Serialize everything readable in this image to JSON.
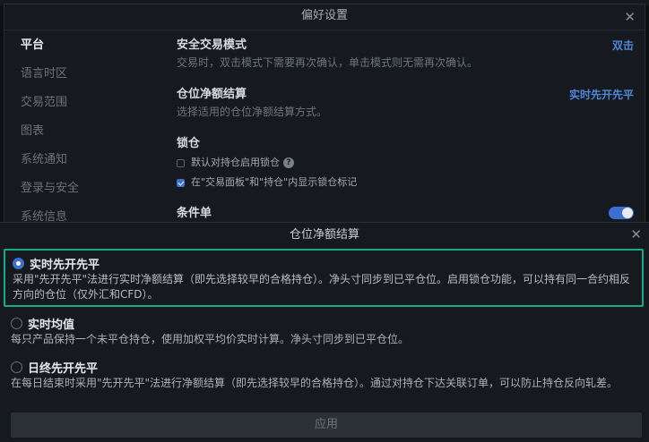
{
  "preferences": {
    "title": "偏好设置",
    "close_glyph": "✕",
    "sidebar": {
      "items": [
        {
          "label": "平台",
          "active": true
        },
        {
          "label": "语言时区",
          "active": false
        },
        {
          "label": "交易范围",
          "active": false
        },
        {
          "label": "图表",
          "active": false
        },
        {
          "label": "系统通知",
          "active": false
        },
        {
          "label": "登录与安全",
          "active": false
        },
        {
          "label": "系统信息",
          "active": false
        }
      ]
    },
    "sections": {
      "safe_trade": {
        "title": "安全交易模式",
        "desc": "交易时，双击模式下需要再次确认，单击模式则无需再次确认。",
        "value": "双击"
      },
      "netting": {
        "title": "仓位净额结算",
        "desc": "选择适用的仓位净额结算方式。",
        "value": "实时先开先平"
      },
      "lock": {
        "title": "锁仓",
        "options": [
          {
            "label": "默认对持仓启用锁仓",
            "checked": false,
            "help": "?"
          },
          {
            "label": "在\"交易面板\"和\"持仓\"内显示锁仓标记",
            "checked": true
          }
        ]
      },
      "conditional": {
        "title": "条件单",
        "enabled": true
      }
    }
  },
  "netting_dialog": {
    "title": "仓位净额结算",
    "close_glyph": "✕",
    "options": [
      {
        "label": "实时先开先平",
        "selected": true,
        "desc": "采用\"先开先平\"法进行实时净额结算（即先选择较早的合格持仓）。净头寸同步到已平仓位。启用锁仓功能，可以持有同一合约相反方向的仓位（仅外汇和CFD）。"
      },
      {
        "label": "实时均值",
        "selected": false,
        "desc": "每只产品保持一个未平仓持仓，使用加权平均价实时计算。净头寸同步到已平仓位。"
      },
      {
        "label": "日终先开先平",
        "selected": false,
        "desc": "在每日结束时采用\"先开先平\"法进行净额结算（即先选择较早的合格持仓）。通过对持仓下达关联订单，可以防止持仓反向轧差。"
      }
    ],
    "apply_label": "应用"
  },
  "colors": {
    "accent": "#3b6fd1",
    "selected_border": "#17a98c",
    "link": "#4e86d8",
    "background": "#16191e"
  }
}
